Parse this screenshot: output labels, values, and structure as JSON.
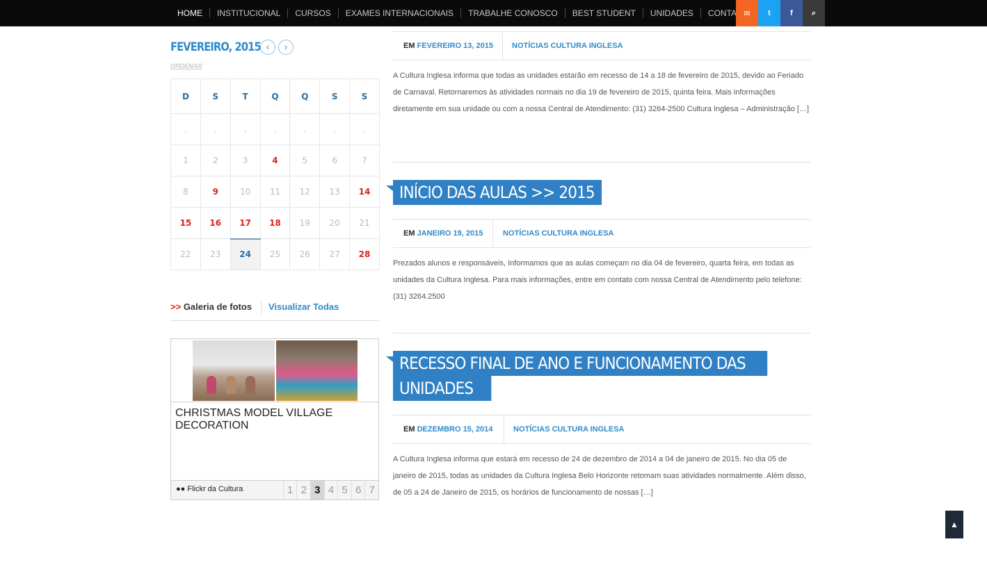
{
  "nav": {
    "items": [
      "HOME",
      "INSTITUCIONAL",
      "CURSOS",
      "EXAMES INTERNACIONAIS",
      "TRABALHE CONOSCO",
      "BEST STUDENT",
      "UNIDADES",
      "CONTATO"
    ]
  },
  "social": {
    "mail": "✉",
    "twitter": "t",
    "facebook": "f",
    "search": "⌕"
  },
  "colors": {
    "accent": "#2f80c4",
    "highlight": "#e02020",
    "nav_bg": "#0a0a0a",
    "mail": "#f26522",
    "twitter": "#1da1f2",
    "facebook": "#3b5998"
  },
  "calendar": {
    "title": "FEVEREIRO, 2015",
    "prev": "‹",
    "next": "›",
    "order_label": "ORDENAR",
    "weekdays": [
      "D",
      "S",
      "T",
      "Q",
      "Q",
      "S",
      "S"
    ],
    "weeks": [
      [
        ".",
        ".",
        ".",
        ".",
        ".",
        ".",
        "."
      ],
      [
        "1",
        "2",
        "3",
        "4",
        "5",
        "6",
        "7"
      ],
      [
        "8",
        "9",
        "10",
        "11",
        "12",
        "13",
        "14"
      ],
      [
        "15",
        "16",
        "17",
        "18",
        "19",
        "20",
        "21"
      ],
      [
        "22",
        "23",
        "24",
        "25",
        "26",
        "27",
        "28"
      ]
    ],
    "highlighted": [
      "4",
      "9",
      "14",
      "15",
      "16",
      "17",
      "18",
      "28"
    ],
    "today": "24"
  },
  "gallery": {
    "arrows": ">>",
    "label": "Galeria de fotos",
    "view_all": "Visualizar Todas",
    "caption": "CHRISTMAS MODEL VILLAGE DECORATION",
    "footer_label": "●● Flickr da Cultura",
    "pages": [
      "1",
      "2",
      "3",
      "4",
      "5",
      "6",
      "7"
    ],
    "active_page": "3"
  },
  "posts": [
    {
      "em": "EM",
      "date": "FEVEREIRO 13, 2015",
      "category": "NOTÍCIAS CULTURA INGLESA",
      "excerpt": " A Cultura Inglesa informa que todas as unidades estarão em recesso de 14 a 18 de fevereiro de 2015, devido ao Feriado de Carnaval. Retornaremos às atividades normais no dia 19 de fevereiro de 2015, quinta feira.   Mais informações diretamente em sua unidade ou com a nossa Central de Atendimento: (31) 3264-2500 Cultura Inglesa – Administração […]"
    },
    {
      "title_lines": [
        "INÍCIO DAS AULAS >> 2015"
      ],
      "em": "EM",
      "date": "JANEIRO 19, 2015",
      "category": "NOTÍCIAS CULTURA INGLESA",
      "excerpt": " Prezados alunos e responsáveis, Informamos que as aulas começam no dia 04 de fevereiro, quarta feira, em todas as unidades da Cultura Inglesa. Para mais informações, entre em contato com nossa Central de Atendimento pelo telefone: (31) 3264.2500"
    },
    {
      "title_lines": [
        "RECESSO FINAL DE ANO E FUNCIONAMENTO DAS",
        "UNIDADES"
      ],
      "em": "EM",
      "date": "DEZEMBRO 15, 2014",
      "category": "NOTÍCIAS CULTURA INGLESA",
      "excerpt": "A Cultura Inglesa informa que estará em recesso de 24 de dezembro de 2014 a 04 de janeiro de 2015. No dia 05 de janeiro de 2015, todas as unidades da Cultura Inglesa Belo Horizonte retomam suas atividades normalmente.  Além disso, de 05 a 24 de Janeiro de 2015, os horários de funcionamento de nossas […]"
    }
  ],
  "scroll_top": "▲"
}
